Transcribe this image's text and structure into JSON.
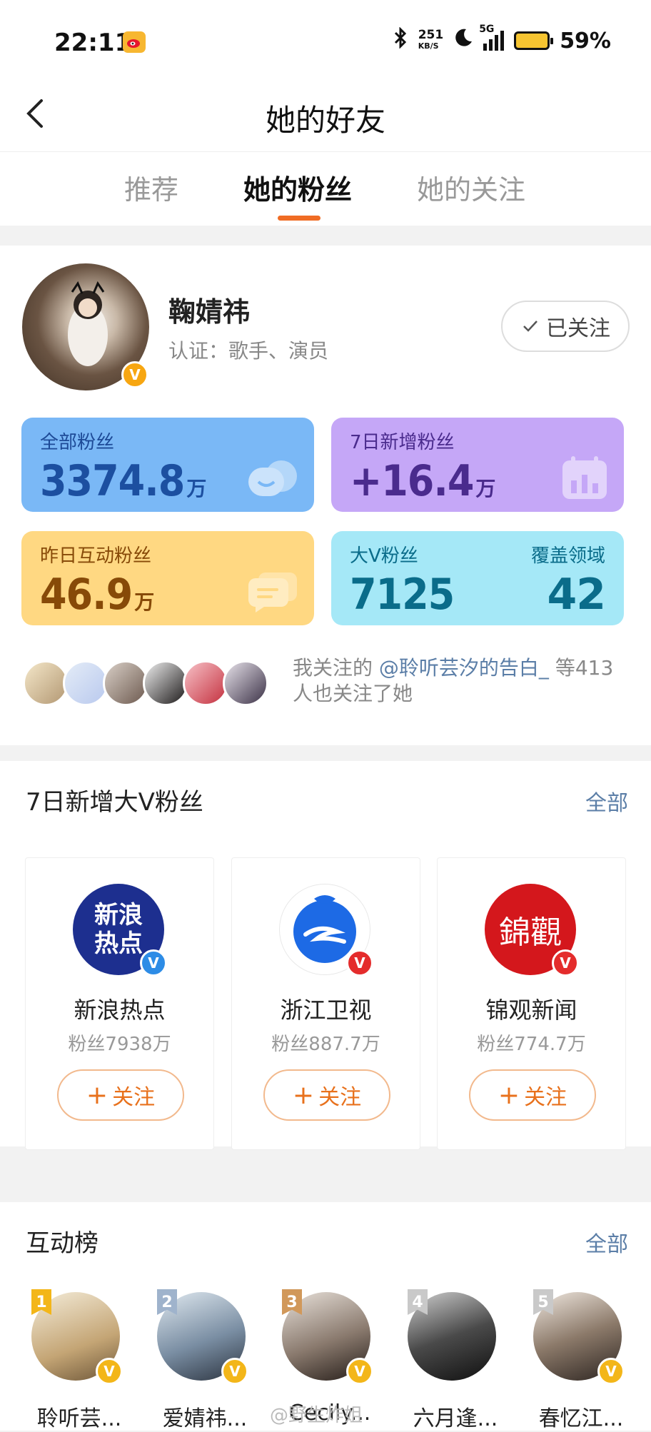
{
  "status_bar": {
    "time": "22:11",
    "net_speed": "251",
    "net_unit": "KB/S",
    "network": "5G",
    "battery": "59%"
  },
  "nav": {
    "title": "她的好友"
  },
  "tabs": [
    {
      "label": "推荐",
      "active": false
    },
    {
      "label": "她的粉丝",
      "active": true
    },
    {
      "label": "她的关注",
      "active": false
    }
  ],
  "profile": {
    "name": "鞠婧祎",
    "verification": "认证：歌手、演员",
    "follow_state": "已关注"
  },
  "stats": {
    "total_fans": {
      "label": "全部粉丝",
      "value": "3374.8",
      "unit": "万"
    },
    "new_7d": {
      "label": "7日新增粉丝",
      "value": "+16.4",
      "unit": "万"
    },
    "yesterday_interactive": {
      "label": "昨日互动粉丝",
      "value": "46.9",
      "unit": "万"
    },
    "bigv": {
      "label": "大V粉丝",
      "value": "7125",
      "coverage_label": "覆盖领域",
      "coverage_value": "42"
    }
  },
  "mutual": {
    "prefix": "我关注的 ",
    "link": "@聆听芸汐的告白_",
    "suffix": " 等413人也关注了她"
  },
  "new_bigv": {
    "title": "7日新增大V粉丝",
    "all_label": "全部",
    "items": [
      {
        "name": "新浪热点",
        "fans": "粉丝7938万",
        "button": "关注",
        "logo_text": "新浪热点"
      },
      {
        "name": "浙江卫视",
        "fans": "粉丝887.7万",
        "button": "关注"
      },
      {
        "name": "锦观新闻",
        "fans": "粉丝774.7万",
        "button": "关注",
        "logo_text": "錦觀"
      }
    ]
  },
  "interaction_rank": {
    "title": "互动榜",
    "all_label": "全部",
    "items": [
      {
        "rank": "1",
        "name": "聆听芸...",
        "color": "#f3b619"
      },
      {
        "rank": "2",
        "name": "爱婧祎...",
        "color": "#9fb3cc"
      },
      {
        "rank": "3",
        "name": "Cecily...",
        "color": "#d1985a"
      },
      {
        "rank": "4",
        "name": "六月逢...",
        "color": "#c9c9c9"
      },
      {
        "rank": "5",
        "name": "春忆江...",
        "color": "#c9c9c9"
      }
    ]
  },
  "watermark": "@野生炸姐",
  "colors": {
    "accent": "#f06c24",
    "link": "#5b7ea7"
  }
}
